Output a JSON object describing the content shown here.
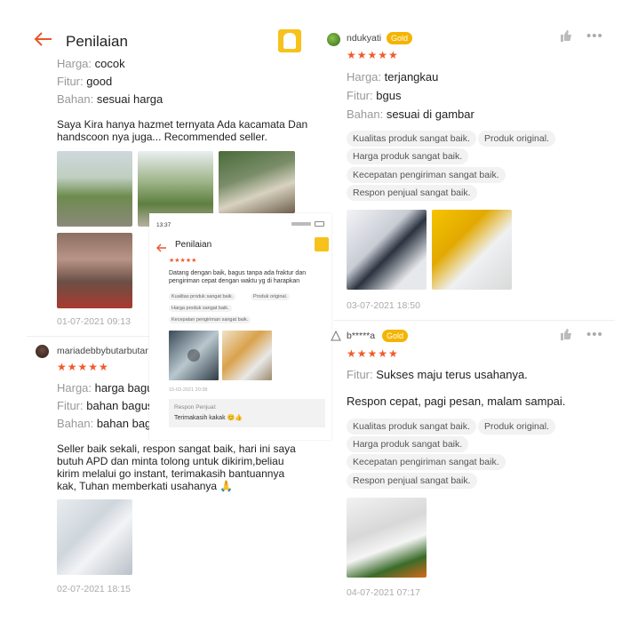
{
  "header": {
    "title": "Penilaian"
  },
  "left": {
    "review1": {
      "attrs": [
        {
          "label": "Harga:",
          "value": "cocok"
        },
        {
          "label": "Fitur:",
          "value": "good"
        },
        {
          "label": "Bahan:",
          "value": "sesuai harga"
        }
      ],
      "text_line1": "Saya Kira hanya hazmet ternyata Ada kacamata Dan",
      "text_line2": "handscoon nya juga... Recommended seller.",
      "date": "01-07-2021 09:13"
    },
    "review2": {
      "user": "mariadebbybutarbutar",
      "stars": "★★★★★",
      "attrs": [
        {
          "label": "Harga:",
          "value": "harga bagus"
        },
        {
          "label": "Fitur:",
          "value": "bahan bagus"
        },
        {
          "label": "Bahan:",
          "value": "bahan bagus"
        }
      ],
      "text_lines": [
        "Seller baik sekali, respon sangat baik,  hari ini saya",
        "butuh APD dan minta tolong untuk dikirim,beliau",
        "kirim melalui go instant,  terimakasih bantuannya",
        "kak, Tuhan memberkati usahanya 🙏"
      ],
      "date": "02-07-2021 18:15"
    }
  },
  "inset": {
    "time": "13:37",
    "title": "Penilaian",
    "stars": "★★★★★",
    "text_line1": "Datang dengan baik, bagus tanpa ada fraktur dan",
    "text_line2": "pengiriman cepat dengan waktu yg di harapkan",
    "tags": [
      "Kualitas produk sangat baik.",
      "Produk original.",
      "Harga produk sangat baik.",
      "Kecepatan pengiriman sangat baik."
    ],
    "date": "15-03-2021 20:38",
    "seller_label": "Respon Penjual:",
    "seller_reply": "Terimakasih kakak 😊👍"
  },
  "right": {
    "review1": {
      "user": "ndukyati",
      "badge": "Gold",
      "stars": "★★★★★",
      "attrs": [
        {
          "label": "Harga:",
          "value": "terjangkau"
        },
        {
          "label": "Fitur:",
          "value": "bgus"
        },
        {
          "label": "Bahan:",
          "value": "sesuai di gambar"
        }
      ],
      "tags": [
        "Kualitas produk sangat baik.",
        "Produk original.",
        "Harga produk sangat baik.",
        "Kecepatan pengiriman sangat baik.",
        "Respon penjual sangat baik."
      ],
      "date": "03-07-2021 18:50"
    },
    "review2": {
      "user": "b*****a",
      "badge": "Gold",
      "stars": "★★★★★",
      "fitur_label": "Fitur:",
      "fitur_value": "Sukses maju terus usahanya.",
      "text": "Respon cepat, pagi pesan, malam sampai.",
      "tags": [
        "Kualitas produk sangat baik.",
        "Produk original.",
        "Harga produk sangat baik.",
        "Kecepatan pengiriman sangat baik.",
        "Respon penjual sangat baik."
      ],
      "date": "04-07-2021 07:17"
    }
  },
  "colors": {
    "accent": "#e8562a",
    "star": "#f05a2b",
    "gold": "#f4b400"
  },
  "icons": [
    "back-arrow-icon",
    "shop-logo-icon",
    "thumbs-up-icon",
    "more-icon",
    "praying-hands-icon"
  ]
}
